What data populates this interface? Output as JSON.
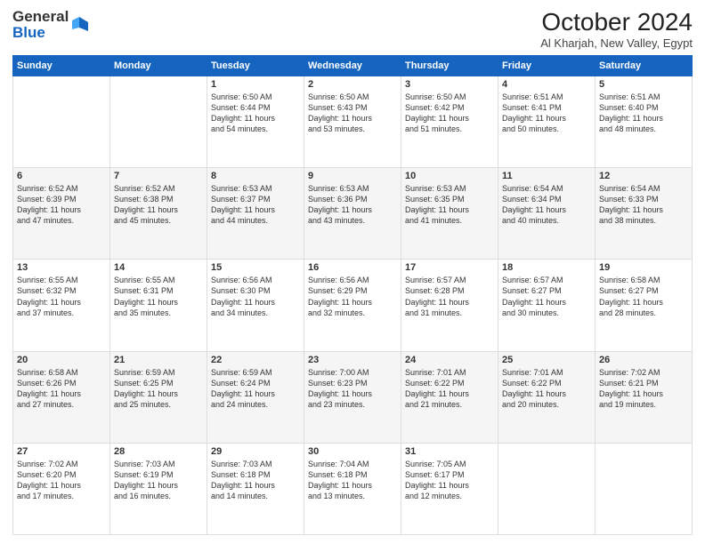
{
  "logo": {
    "general": "General",
    "blue": "Blue"
  },
  "header": {
    "month": "October 2024",
    "location": "Al Kharjah, New Valley, Egypt"
  },
  "days": [
    "Sunday",
    "Monday",
    "Tuesday",
    "Wednesday",
    "Thursday",
    "Friday",
    "Saturday"
  ],
  "weeks": [
    [
      {
        "day": "",
        "content": ""
      },
      {
        "day": "",
        "content": ""
      },
      {
        "day": "1",
        "content": "Sunrise: 6:50 AM\nSunset: 6:44 PM\nDaylight: 11 hours\nand 54 minutes."
      },
      {
        "day": "2",
        "content": "Sunrise: 6:50 AM\nSunset: 6:43 PM\nDaylight: 11 hours\nand 53 minutes."
      },
      {
        "day": "3",
        "content": "Sunrise: 6:50 AM\nSunset: 6:42 PM\nDaylight: 11 hours\nand 51 minutes."
      },
      {
        "day": "4",
        "content": "Sunrise: 6:51 AM\nSunset: 6:41 PM\nDaylight: 11 hours\nand 50 minutes."
      },
      {
        "day": "5",
        "content": "Sunrise: 6:51 AM\nSunset: 6:40 PM\nDaylight: 11 hours\nand 48 minutes."
      }
    ],
    [
      {
        "day": "6",
        "content": "Sunrise: 6:52 AM\nSunset: 6:39 PM\nDaylight: 11 hours\nand 47 minutes."
      },
      {
        "day": "7",
        "content": "Sunrise: 6:52 AM\nSunset: 6:38 PM\nDaylight: 11 hours\nand 45 minutes."
      },
      {
        "day": "8",
        "content": "Sunrise: 6:53 AM\nSunset: 6:37 PM\nDaylight: 11 hours\nand 44 minutes."
      },
      {
        "day": "9",
        "content": "Sunrise: 6:53 AM\nSunset: 6:36 PM\nDaylight: 11 hours\nand 43 minutes."
      },
      {
        "day": "10",
        "content": "Sunrise: 6:53 AM\nSunset: 6:35 PM\nDaylight: 11 hours\nand 41 minutes."
      },
      {
        "day": "11",
        "content": "Sunrise: 6:54 AM\nSunset: 6:34 PM\nDaylight: 11 hours\nand 40 minutes."
      },
      {
        "day": "12",
        "content": "Sunrise: 6:54 AM\nSunset: 6:33 PM\nDaylight: 11 hours\nand 38 minutes."
      }
    ],
    [
      {
        "day": "13",
        "content": "Sunrise: 6:55 AM\nSunset: 6:32 PM\nDaylight: 11 hours\nand 37 minutes."
      },
      {
        "day": "14",
        "content": "Sunrise: 6:55 AM\nSunset: 6:31 PM\nDaylight: 11 hours\nand 35 minutes."
      },
      {
        "day": "15",
        "content": "Sunrise: 6:56 AM\nSunset: 6:30 PM\nDaylight: 11 hours\nand 34 minutes."
      },
      {
        "day": "16",
        "content": "Sunrise: 6:56 AM\nSunset: 6:29 PM\nDaylight: 11 hours\nand 32 minutes."
      },
      {
        "day": "17",
        "content": "Sunrise: 6:57 AM\nSunset: 6:28 PM\nDaylight: 11 hours\nand 31 minutes."
      },
      {
        "day": "18",
        "content": "Sunrise: 6:57 AM\nSunset: 6:27 PM\nDaylight: 11 hours\nand 30 minutes."
      },
      {
        "day": "19",
        "content": "Sunrise: 6:58 AM\nSunset: 6:27 PM\nDaylight: 11 hours\nand 28 minutes."
      }
    ],
    [
      {
        "day": "20",
        "content": "Sunrise: 6:58 AM\nSunset: 6:26 PM\nDaylight: 11 hours\nand 27 minutes."
      },
      {
        "day": "21",
        "content": "Sunrise: 6:59 AM\nSunset: 6:25 PM\nDaylight: 11 hours\nand 25 minutes."
      },
      {
        "day": "22",
        "content": "Sunrise: 6:59 AM\nSunset: 6:24 PM\nDaylight: 11 hours\nand 24 minutes."
      },
      {
        "day": "23",
        "content": "Sunrise: 7:00 AM\nSunset: 6:23 PM\nDaylight: 11 hours\nand 23 minutes."
      },
      {
        "day": "24",
        "content": "Sunrise: 7:01 AM\nSunset: 6:22 PM\nDaylight: 11 hours\nand 21 minutes."
      },
      {
        "day": "25",
        "content": "Sunrise: 7:01 AM\nSunset: 6:22 PM\nDaylight: 11 hours\nand 20 minutes."
      },
      {
        "day": "26",
        "content": "Sunrise: 7:02 AM\nSunset: 6:21 PM\nDaylight: 11 hours\nand 19 minutes."
      }
    ],
    [
      {
        "day": "27",
        "content": "Sunrise: 7:02 AM\nSunset: 6:20 PM\nDaylight: 11 hours\nand 17 minutes."
      },
      {
        "day": "28",
        "content": "Sunrise: 7:03 AM\nSunset: 6:19 PM\nDaylight: 11 hours\nand 16 minutes."
      },
      {
        "day": "29",
        "content": "Sunrise: 7:03 AM\nSunset: 6:18 PM\nDaylight: 11 hours\nand 14 minutes."
      },
      {
        "day": "30",
        "content": "Sunrise: 7:04 AM\nSunset: 6:18 PM\nDaylight: 11 hours\nand 13 minutes."
      },
      {
        "day": "31",
        "content": "Sunrise: 7:05 AM\nSunset: 6:17 PM\nDaylight: 11 hours\nand 12 minutes."
      },
      {
        "day": "",
        "content": ""
      },
      {
        "day": "",
        "content": ""
      }
    ]
  ]
}
